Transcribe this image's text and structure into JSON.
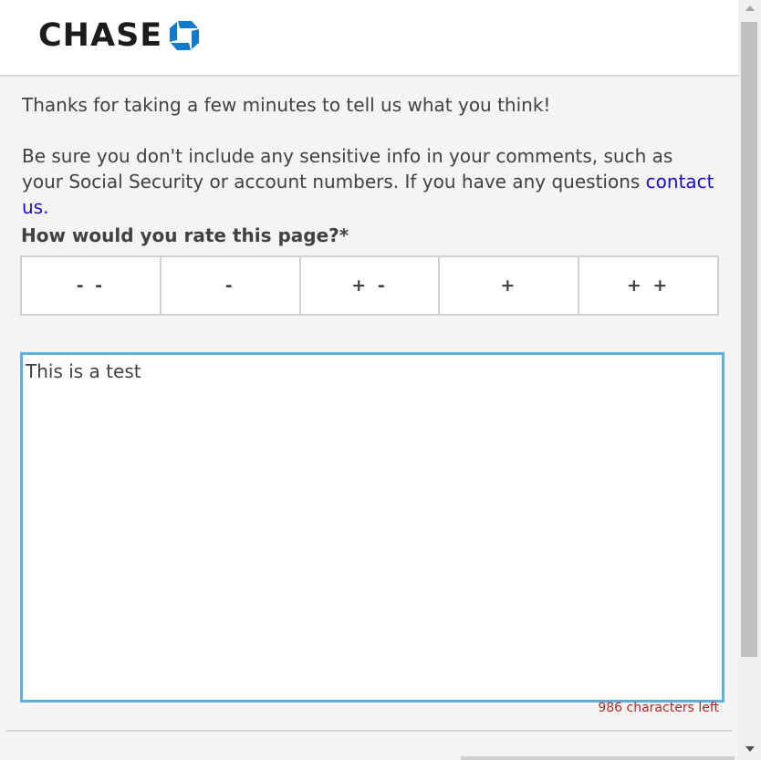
{
  "brand": {
    "name": "CHASE",
    "logo_icon": "chase-octagon-icon",
    "color": "#117aca"
  },
  "intro": {
    "thanks": "Thanks for taking a few minutes to tell us what you think!",
    "notice": "Be sure you don't include any sensitive info in your comments, such as your Social Security or account numbers. If you have any questions",
    "contact_link": "contact us."
  },
  "rating": {
    "label": "How would you rate this page?*",
    "options": [
      "- -",
      "-",
      "+ -",
      "+",
      "+ +"
    ]
  },
  "comment": {
    "value": "This is a test",
    "counter": "986 characters left",
    "focus_color": "#5ab0e2"
  }
}
